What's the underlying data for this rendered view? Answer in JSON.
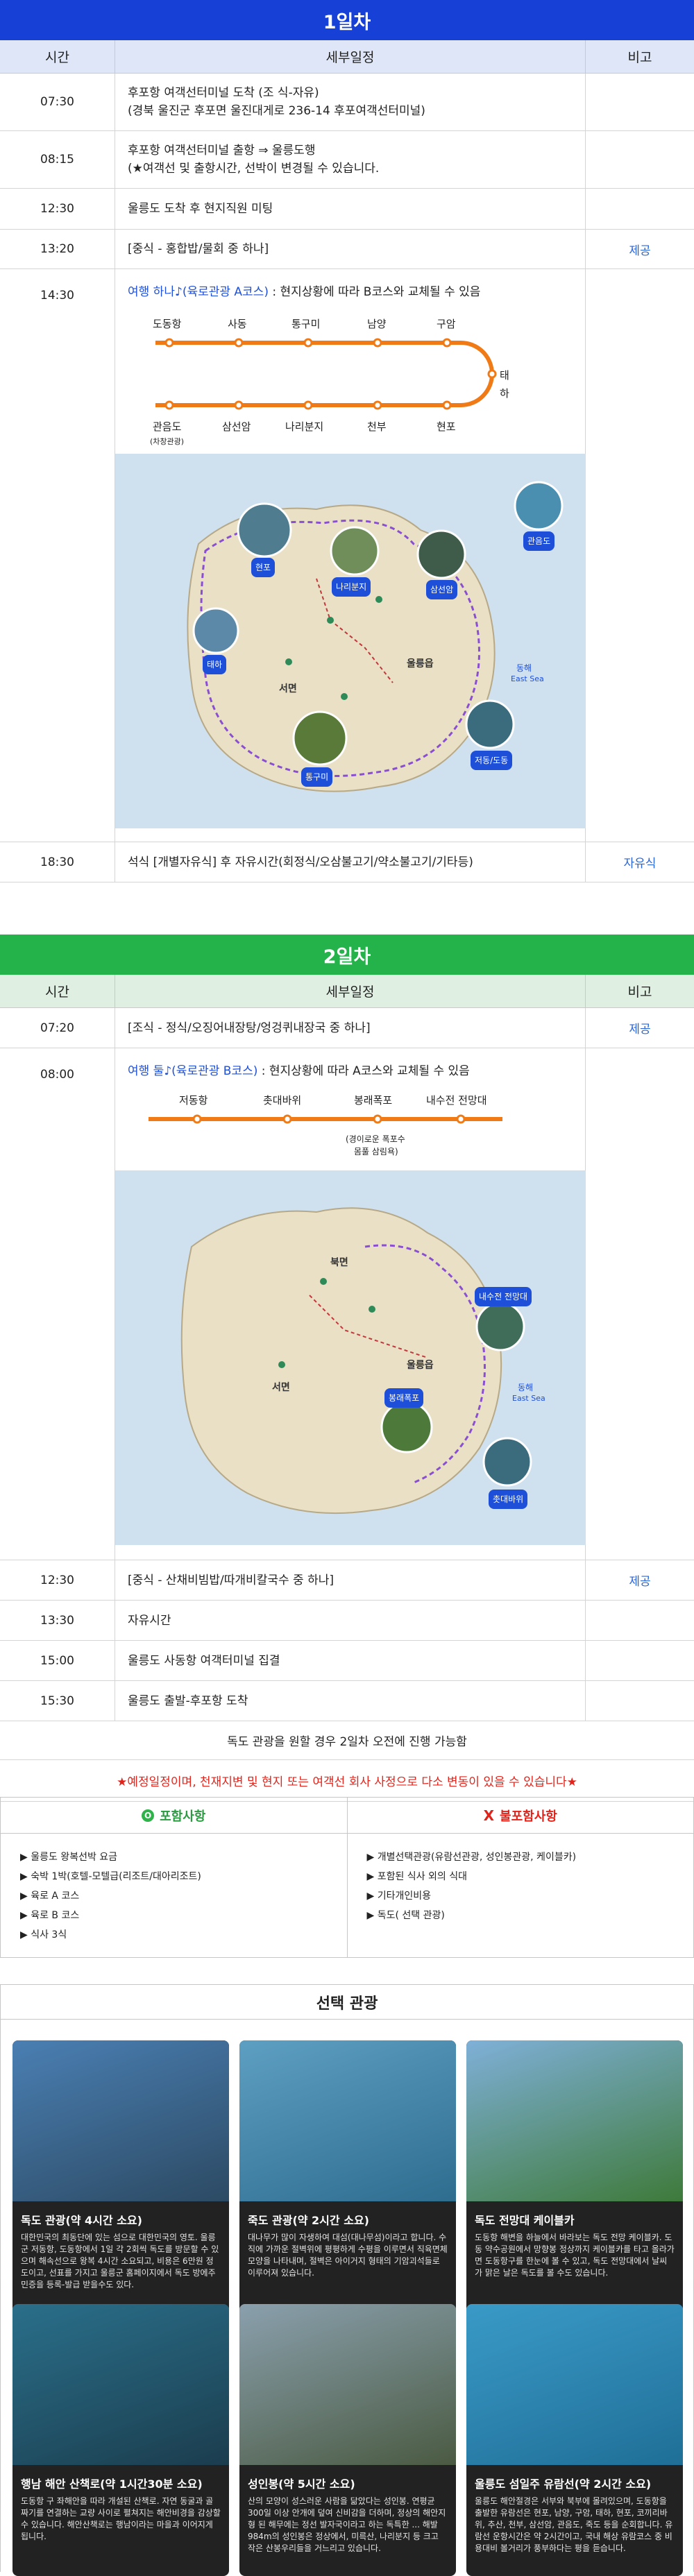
{
  "day1": {
    "title": "1일차",
    "headers": [
      "시간",
      "세부일정",
      "비고"
    ],
    "rows": [
      {
        "time": "07:30",
        "desc1": "후포항 여객선터미널 도착 (조 식-자유)",
        "desc2": "(경북 울진군 후포면 울진대게로 236-14 후포여객선터미널)",
        "note": ""
      },
      {
        "time": "08:15",
        "desc1": "후포항 여객선터미널 출항 ⇒ 울릉도행",
        "desc2": "(★여객선 및 출항시간, 선박이 변경될 수 있습니다.",
        "note": ""
      },
      {
        "time": "12:30",
        "desc1": "울릉도 도착 후 현지직원 미팅",
        "desc2": "",
        "note": ""
      },
      {
        "time": "13:20",
        "desc1": "[중식 - 홍합밥/물회 중 하나]",
        "desc2": "",
        "note": "제공"
      },
      {
        "time": "14:30",
        "desc_blue": "여행 하나♪(육로관광 A코스)",
        "desc_rest": " : 현지상황에 따라 B코스와 교체될 수 있음",
        "note": ""
      },
      {
        "time": "18:30",
        "desc1": "석식 [개별자유식] 후 자유시간(회정식/오삼불고기/약소불고기/기타등)",
        "desc2": "",
        "note": "자유식"
      }
    ],
    "route_top": [
      "도동항",
      "사동",
      "통구미",
      "남양",
      "구암"
    ],
    "route_turn": "태하",
    "route_bottom": [
      "관음도",
      "삼선암",
      "나리분지",
      "천부",
      "현포"
    ],
    "route_bottom_sub": "(차창관광)",
    "map_labels": [
      "현포",
      "나리분지",
      "삼선암",
      "관음도",
      "태하",
      "서면",
      "울릉읍",
      "통구미",
      "저동/도동",
      "동해",
      "East Sea"
    ]
  },
  "day2": {
    "title": "2일차",
    "headers": [
      "시간",
      "세부일정",
      "비고"
    ],
    "rows": [
      {
        "time": "07:20",
        "desc1": "[조식 - 정식/오징어내장탕/엉겅퀴내장국 중 하나]",
        "note": "제공"
      },
      {
        "time": "08:00",
        "desc_blue": "여행 둘♪(육로관광 B코스)",
        "desc_rest": " : 현지상황에 따라 A코스와 교체될 수 있음",
        "note": ""
      },
      {
        "time": "12:30",
        "desc1": "[중식 - 산채비빔밥/따개비칼국수 중 하나]",
        "note": "제공"
      },
      {
        "time": "13:30",
        "desc1": "자유시간",
        "note": ""
      },
      {
        "time": "15:00",
        "desc1": "울릉도 사동항 여객터미널 집결",
        "note": ""
      },
      {
        "time": "15:30",
        "desc1": "울릉도 출발-후포항 도착",
        "note": ""
      }
    ],
    "route": [
      "저동항",
      "촛대바위",
      "봉래폭포",
      "내수전 전망대"
    ],
    "route_sub": [
      "(경이로운 폭포수",
      "몸풀 삼림욕)"
    ],
    "map_labels": [
      "북면",
      "내수전 전망대",
      "울릉읍",
      "서면",
      "봉래폭포",
      "촛대바위",
      "동해",
      "East Sea"
    ],
    "notice": "독도 관광을 원할 경우 2일차 오전에 진행 가능함",
    "warning": "★예정일정이며, 천재지변 및 현지 또는 여객선 회사 사정으로 다소 변동이 있을 수 있습니다★"
  },
  "inclusions": {
    "included_title": "포함사항",
    "excluded_title": "불포함사항",
    "included": [
      "울릉도 왕복선박 요금",
      "숙박 1박(호텔-모텔급(리조트/대아리조트)",
      "육로 A 코스",
      "육로 B 코스",
      "식사 3식"
    ],
    "excluded": [
      "개별선택관광(유람선관광, 성인봉관광, 케이블카)",
      "포함된 식사 외의 식대",
      "기타개인비용",
      "독도( 선택 관광)"
    ]
  },
  "options": {
    "title": "선택 관광",
    "cards": [
      {
        "title": "독도 관광(약 4시간 소요)",
        "text": "대한민국의 최동단에 있는 섬으로 대한민국의 영토. 울릉군 저동항, 도동항에서 1일 각 2회씩 독도를 방문할 수 있으며 해속선으로 왕복 4시간 소요되고, 비용은 6만원 정도이고, 선표를 가지고 울릉군 홈페이지에서 독도 방에주민증을 등록-발급 받을수도 있다.",
        "colors": [
          "#4a7fb3",
          "#2c4a63"
        ]
      },
      {
        "title": "죽도 관광(약 2시간 소요)",
        "text": "대나무가 많이 자생하여 대섬(대나무섬)이라고 합니다. 수직에 가까운 절벽위에 평평하게 수평을 이루면서 직육면체 모양을 나타내며, 절벽은 아이거지 형태의 기암괴석들로 이루어져 있습니다.",
        "colors": [
          "#5d9fc2",
          "#2f6d8f"
        ]
      },
      {
        "title": "독도 전망대 케이블카",
        "text": "도동항 해변을 하늘에서 바라보는 독도 전망 케이블카. 도동 약수공원에서 망향봉 정상까지 케이블카를 타고 올라가면 도동항구를 한눈에 볼 수 있고, 독도 전망대에서 날씨가 맑은 날은 독도를 볼 수도 있습니다.",
        "colors": [
          "#7fb0d8",
          "#3e7a3a"
        ]
      },
      {
        "title": "행남 해안 산책로(약 1시간30분 소요)",
        "text": "도동항 구 좌해안을 따라 개설된 산책로. 자연 동굴과 골짜기를 연결하는 교량 사이로 펼쳐지는 해안비경을 감상할 수 있습니다. 해안산책로는 행남이라는 마을과 이어지게 됩니다.",
        "colors": [
          "#2a6f8a",
          "#1b3d4e"
        ]
      },
      {
        "title": "성인봉(약 5시간 소요)",
        "text": "산의 모양이 성스러운 사람을 닮았다는 성인봉. 연평균 300일 이상 안개에 덮여 신비감을 더하며, 정상의 해안지형 된 해무에는 정선 발자국이라고 하는 독특한 ... 해발 984m의 성인봉은 정상에서, 미륵산, 나리분지 등 크고 작은 산봉우리들을 거느리고 있습니다.",
        "colors": [
          "#8aa0ad",
          "#4a5a42"
        ]
      },
      {
        "title": "울릉도 섬일주 유람선(약 2시간 소요)",
        "text": "울릉도 해안절경은 서부와 북부에 몰려있으며, 도동항을 출발한 유람선은 현포, 남양, 구암, 태하, 현포, 코끼리바위, 추산, 천부, 삼선암, 관음도, 죽도 등을 순회합니다. 유람선 운항시간은 약 2시간이고, 국내 해상 유람코스 중 비용대비 볼거리가 풍부하다는 평을 듣습니다.",
        "colors": [
          "#3a9ac7",
          "#1f6f97"
        ]
      }
    ]
  }
}
